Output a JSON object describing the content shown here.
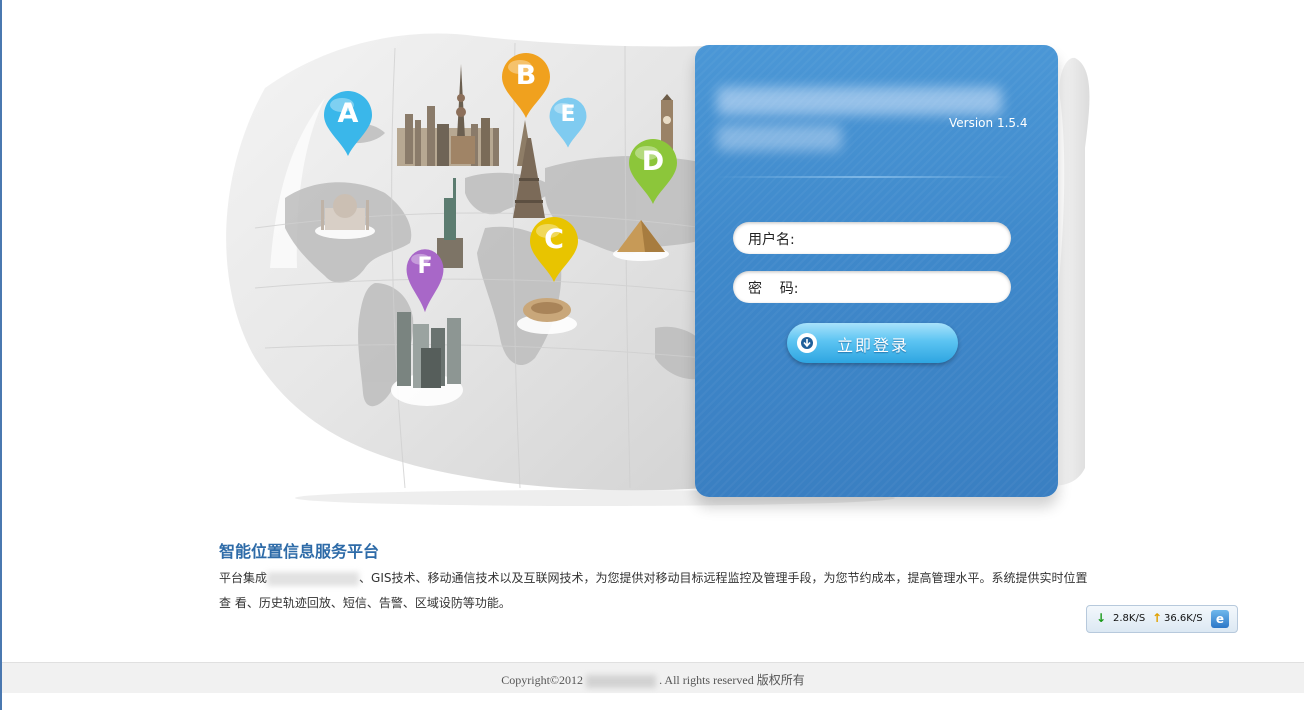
{
  "login": {
    "version": "Version 1.5.4",
    "username_label": "用户名:",
    "password_label": "密    码:",
    "submit_label": "立即登录"
  },
  "pins": [
    {
      "letter": "A",
      "color": "#3ab7ea"
    },
    {
      "letter": "B",
      "color": "#f0a11e"
    },
    {
      "letter": "C",
      "color": "#e8c400"
    },
    {
      "letter": "D",
      "color": "#8cc63a"
    },
    {
      "letter": "E",
      "color": "#7fcbf0"
    },
    {
      "letter": "F",
      "color": "#a867c8"
    }
  ],
  "description": {
    "title": "智能位置信息服务平台",
    "text_part1": "平台集成",
    "text_part2": "、GIS技术、移动通信技术以及互联网技术，为您提供对移动目标远程监控及管理手段，为您节约成本，提高管理水平。系统提供实时位置查 看、历史轨迹回放、短信、告警、区域设防等功能。"
  },
  "speed": {
    "download": "2.8K/S",
    "upload": "36.6K/S",
    "ie_label": "e"
  },
  "footer": {
    "copyright_prefix": "Copyright©2012",
    "copyright_suffix": ". All rights reserved 版权所有"
  },
  "colors": {
    "panel_blue": "#3f89cb",
    "title_blue": "#2e6ba8",
    "button_blue": "#2ea5e1"
  }
}
